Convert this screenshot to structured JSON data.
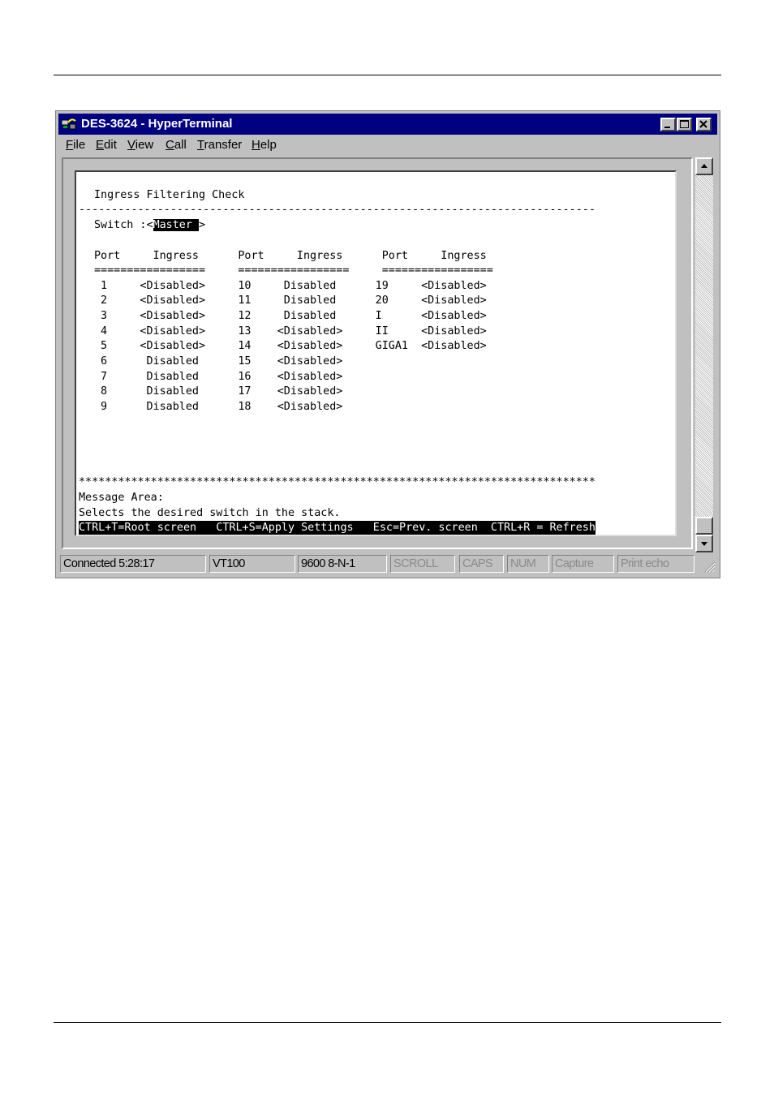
{
  "window": {
    "title": "DES-3624 - HyperTerminal",
    "controls": {
      "minimize": "_",
      "maximize": "□",
      "close": "×"
    }
  },
  "menu": [
    {
      "key": "F",
      "rest": "ile"
    },
    {
      "key": "E",
      "rest": "dit"
    },
    {
      "key": "V",
      "rest": "iew"
    },
    {
      "key": "C",
      "rest": "all"
    },
    {
      "key": "T",
      "rest": "ransfer"
    },
    {
      "key": "H",
      "rest": "elp"
    }
  ],
  "terminal": {
    "heading": "Ingress Filtering Check",
    "dash_line": "-------------------------------------------------------------------------------",
    "switch_label": "Switch :<",
    "switch_value": "Master ",
    "switch_close": ">",
    "col_header": "Port     Ingress      Port     Ingress      Port     Ingress",
    "col_rule": "=================     =================     =================",
    "rows": [
      " 1     <Disabled>     10     Disabled      19     <Disabled>",
      " 2     <Disabled>     11     Disabled      20     <Disabled>",
      " 3     <Disabled>     12     Disabled      I      <Disabled>",
      " 4     <Disabled>     13    <Disabled>     II     <Disabled>",
      " 5     <Disabled>     14    <Disabled>     GIGA1  <Disabled>",
      " 6      Disabled      15    <Disabled>",
      " 7      Disabled      16    <Disabled>",
      " 8      Disabled      17    <Disabled>",
      " 9      Disabled      18    <Disabled>"
    ],
    "star_line": "*******************************************************************************",
    "message_label": "Message Area:",
    "message_text": "Selects the desired switch in the stack.",
    "help_bar": "CTRL+T=Root screen   CTRL+S=Apply Settings   Esc=Prev. screen  CTRL+R = Refresh"
  },
  "status": {
    "connected": "Connected 5:28:17",
    "emulation": "VT100",
    "settings": "9600 8-N-1",
    "scroll": "SCROLL",
    "caps": "CAPS",
    "num": "NUM",
    "capture": "Capture",
    "print_echo": "Print echo"
  }
}
